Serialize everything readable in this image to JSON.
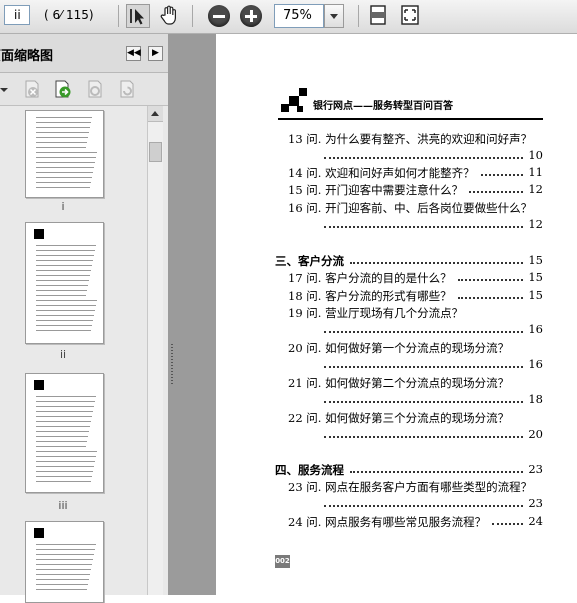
{
  "toolbar": {
    "page_input": "ii",
    "page_count": "( 6⁄ 115)",
    "zoom": "75%"
  },
  "sidebar": {
    "title": "页面缩略图",
    "prev_btn": "◀◀",
    "next_btn": "▶",
    "thumbnails": [
      {
        "label": "i"
      },
      {
        "label": "ii"
      },
      {
        "label": "iii"
      },
      {
        "label": ""
      }
    ]
  },
  "document": {
    "running_header": "银行网点——服务转型百问百答",
    "entries": [
      {
        "kind": "q",
        "text": "13 问. 为什么要有整齐、洪亮的欢迎和问好声？",
        "page": "10",
        "wrap": true
      },
      {
        "kind": "q",
        "text": "14 问. 欢迎和问好声如何才能整齐？",
        "page": "11",
        "wrap": false
      },
      {
        "kind": "q",
        "text": "15 问. 开门迎客中需要注意什么？",
        "page": "12",
        "wrap": false
      },
      {
        "kind": "q",
        "text": "16 问. 开门迎客前、中、后各岗位要做些什么？",
        "page": "12",
        "wrap": true
      },
      {
        "kind": "sec",
        "text": "三、客户分流",
        "page": "15",
        "wrap": false
      },
      {
        "kind": "q",
        "text": "17 问. 客户分流的目的是什么？",
        "page": "15",
        "wrap": false
      },
      {
        "kind": "q",
        "text": "18 问. 客户分流的形式有哪些？",
        "page": "15",
        "wrap": false
      },
      {
        "kind": "q",
        "text": "19 问. 营业厅现场有几个分流点？",
        "page": "16",
        "wrap": true
      },
      {
        "kind": "q",
        "text": "20 问. 如何做好第一个分流点的现场分流？",
        "page": "16",
        "wrap": true
      },
      {
        "kind": "q",
        "text": "21 问. 如何做好第二个分流点的现场分流？",
        "page": "18",
        "wrap": true
      },
      {
        "kind": "q",
        "text": "22 问. 如何做好第三个分流点的现场分流？",
        "page": "20",
        "wrap": true
      },
      {
        "kind": "sec",
        "text": "四、服务流程",
        "page": "23",
        "wrap": false
      },
      {
        "kind": "q",
        "text": "23 问. 网点在服务客户方面有哪些类型的流程？",
        "page": "23",
        "wrap": true
      },
      {
        "kind": "q",
        "text": "24 问. 网点服务有哪些常见服务流程？",
        "page": "24",
        "wrap": false
      }
    ],
    "footer_page": "002"
  }
}
